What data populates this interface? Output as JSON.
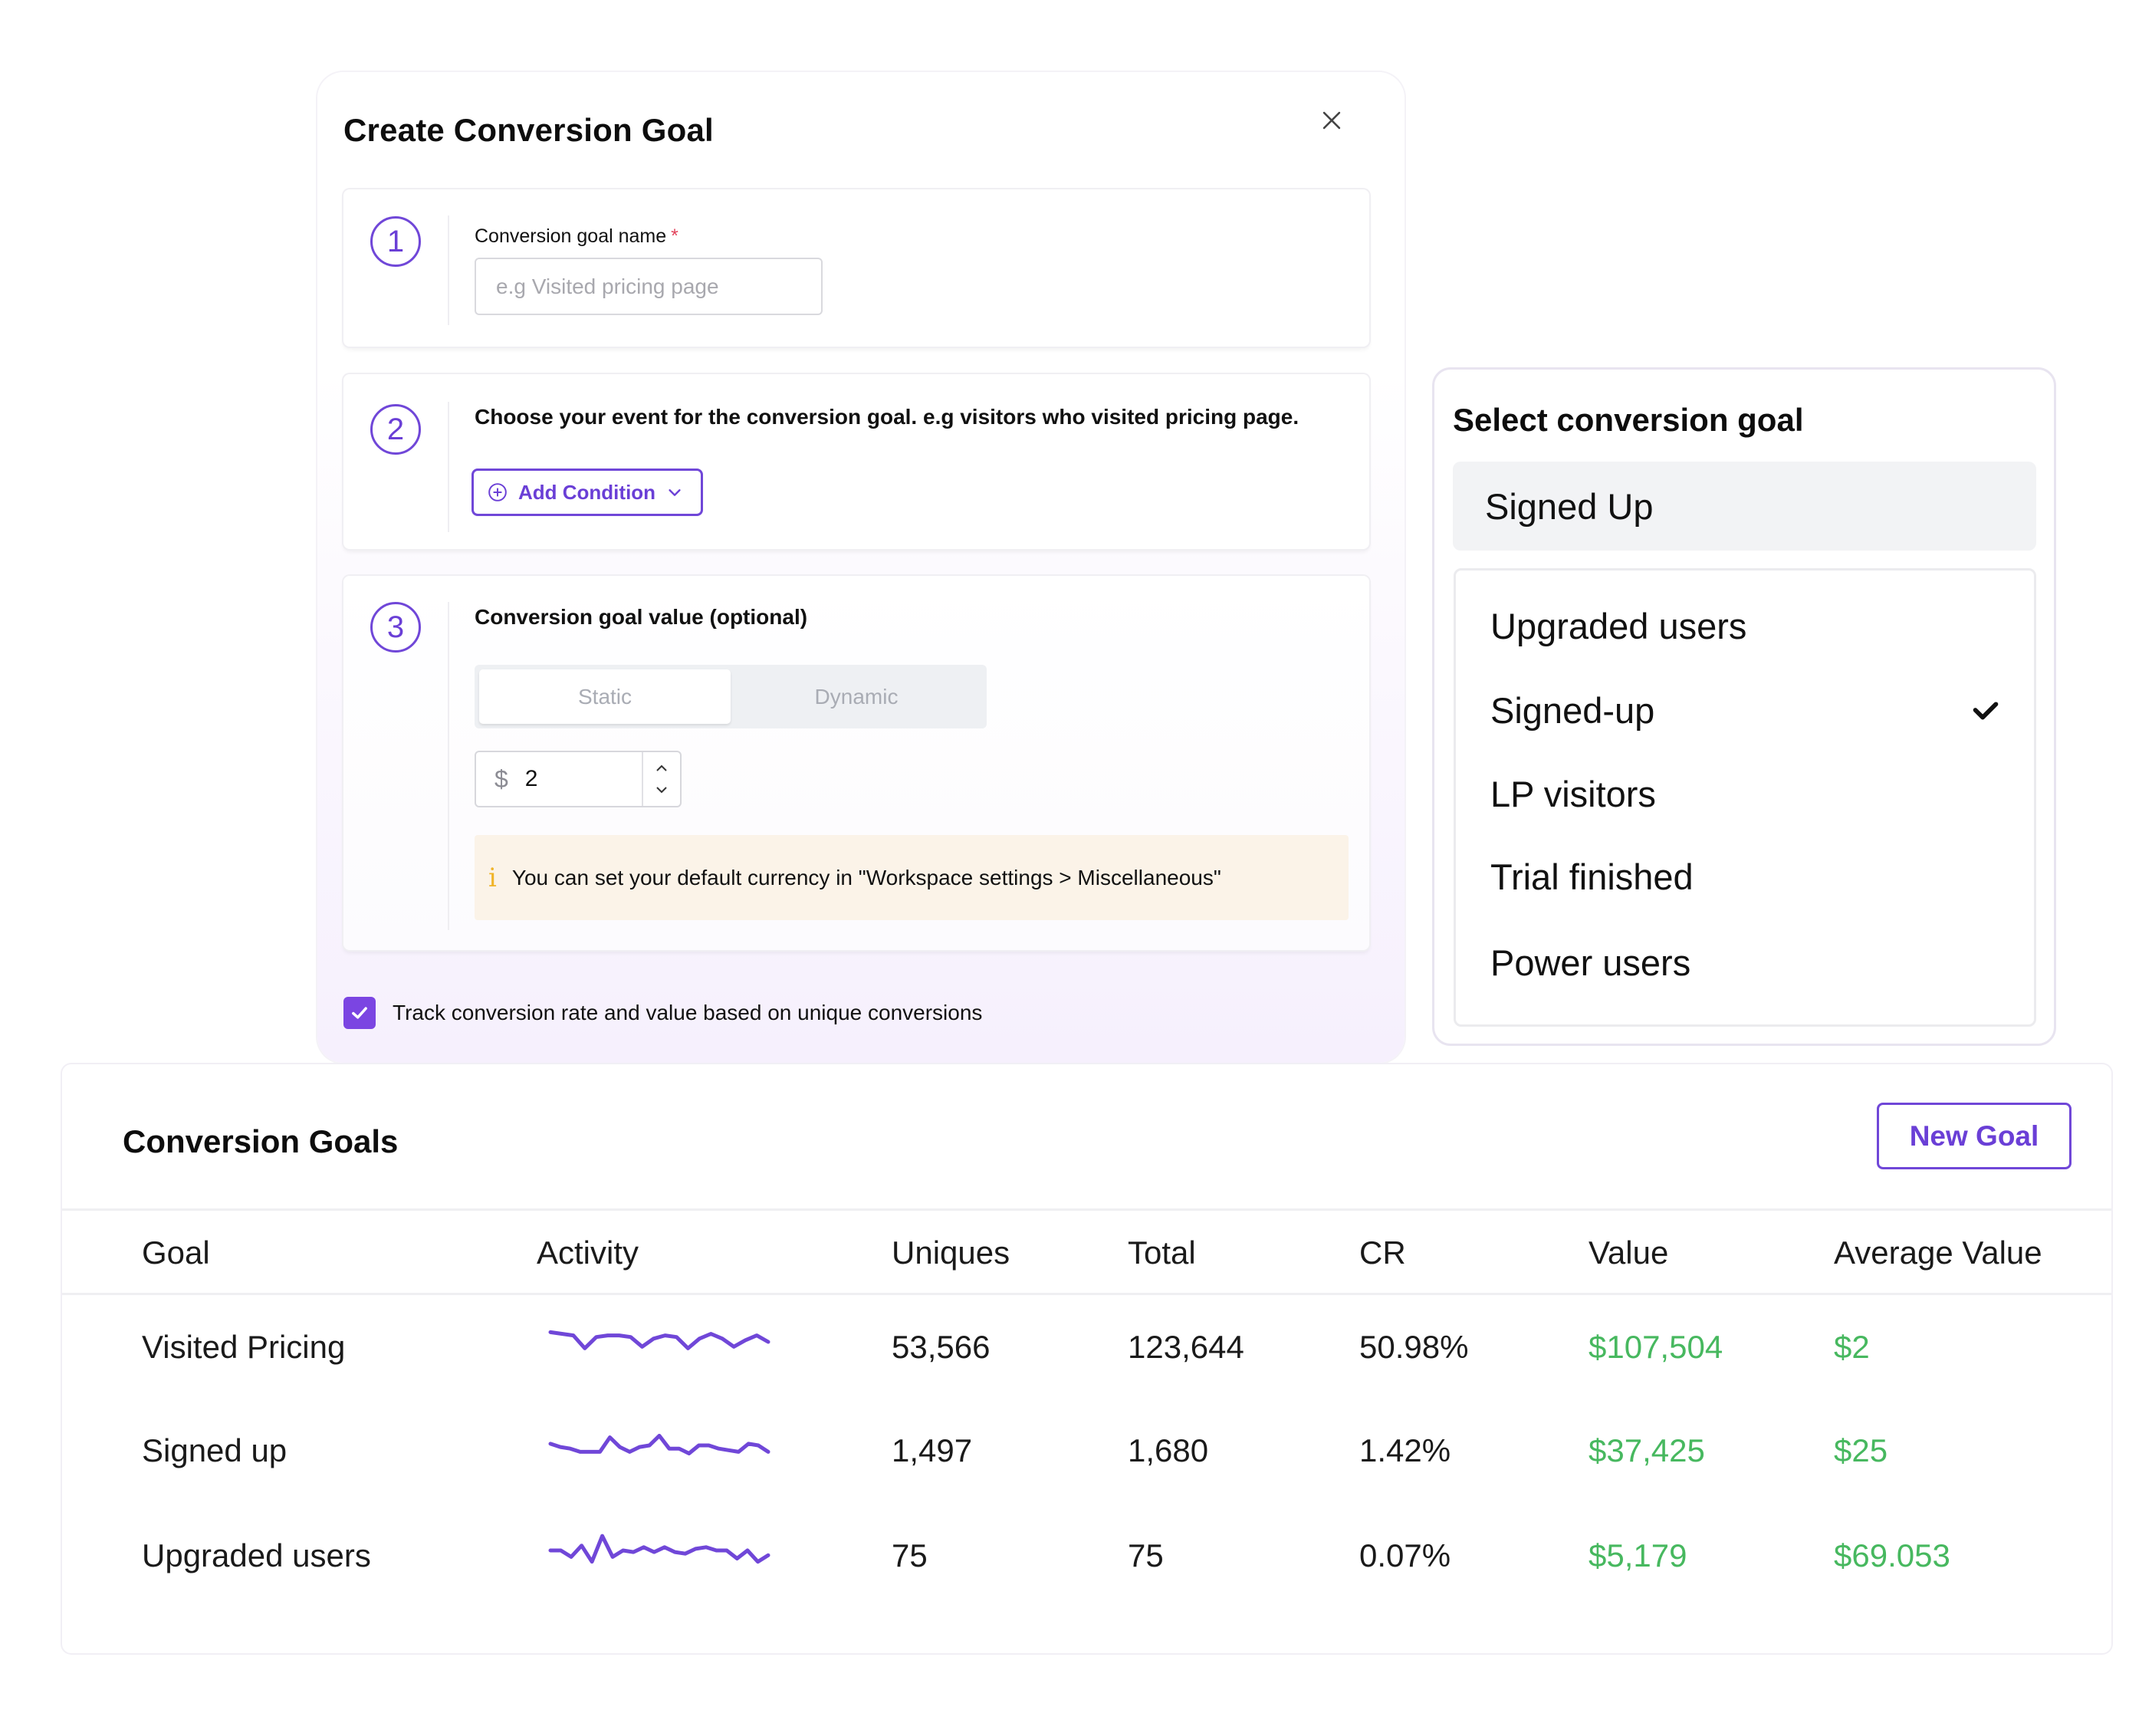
{
  "modal": {
    "title": "Create Conversion Goal",
    "close_icon": "close-icon",
    "step1": {
      "number": "1",
      "label": "Conversion goal name",
      "required_marker": "*",
      "input_value": "",
      "input_placeholder": "e.g Visited pricing page"
    },
    "step2": {
      "number": "2",
      "heading": "Choose your event for the conversion goal. e.g visitors who visited pricing page.",
      "add_condition_label": "Add Condition",
      "add_icon": "plus-circle-icon",
      "chevron_icon": "chevron-down-icon"
    },
    "step3": {
      "number": "3",
      "heading": "Conversion goal value (optional)",
      "segments": [
        {
          "label": "Static",
          "active": true
        },
        {
          "label": "Dynamic",
          "active": false
        }
      ],
      "currency_symbol": "$",
      "value": "2",
      "info_icon": "info-icon",
      "info_text": "You can set your default currency in \"Workspace settings > Miscellaneous\""
    },
    "track_checkbox": {
      "checked": true,
      "label": "Track conversion rate and value based on unique conversions"
    }
  },
  "select_panel": {
    "title": "Select conversion goal",
    "selected_value": "Signed Up",
    "options": [
      {
        "label": "Upgraded users",
        "checked": false
      },
      {
        "label": "Signed-up",
        "checked": true
      },
      {
        "label": "LP visitors",
        "checked": false
      },
      {
        "label": "Trial finished",
        "checked": false
      },
      {
        "label": "Power users",
        "checked": false
      }
    ]
  },
  "goals_table": {
    "title": "Conversion Goals",
    "new_goal_label": "New Goal",
    "columns": [
      "Goal",
      "Activity",
      "Uniques",
      "Total",
      "CR",
      "Value",
      "Average Value"
    ],
    "rows": [
      {
        "goal": "Visited Pricing",
        "uniques": "53,566",
        "total": "123,644",
        "cr": "50.98%",
        "value": "$107,504",
        "avg_value": "$2",
        "activity": [
          0.8,
          0.75,
          0.7,
          0.3,
          0.65,
          0.7,
          0.7,
          0.65,
          0.35,
          0.6,
          0.7,
          0.65,
          0.3,
          0.6,
          0.75,
          0.6,
          0.35,
          0.55,
          0.7,
          0.5
        ]
      },
      {
        "goal": "Signed up",
        "uniques": "1,497",
        "total": "1,680",
        "cr": "1.42%",
        "value": "$37,425",
        "avg_value": "$25",
        "activity": [
          0.55,
          0.45,
          0.4,
          0.3,
          0.3,
          0.3,
          0.75,
          0.45,
          0.3,
          0.45,
          0.5,
          0.8,
          0.4,
          0.4,
          0.25,
          0.5,
          0.5,
          0.4,
          0.35,
          0.3,
          0.55,
          0.5,
          0.3
        ]
      },
      {
        "goal": "Upgraded users",
        "uniques": "75",
        "total": "75",
        "cr": "0.07%",
        "value": "$5,179",
        "avg_value": "$69.053",
        "activity": [
          0.5,
          0.5,
          0.3,
          0.65,
          0.15,
          0.95,
          0.3,
          0.5,
          0.45,
          0.6,
          0.45,
          0.6,
          0.45,
          0.4,
          0.55,
          0.6,
          0.5,
          0.5,
          0.25,
          0.5,
          0.15,
          0.35
        ]
      }
    ],
    "accent_color": "#7047d8",
    "money_color": "#47b85f"
  }
}
